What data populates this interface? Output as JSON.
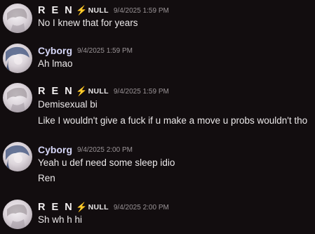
{
  "messages": [
    {
      "author": "R E N",
      "badge": {
        "icon": "lightning-bolt-icon",
        "label": "NULL"
      },
      "timestamp": "9/4/2025 1:59 PM",
      "lines": [
        "No I knew that for years"
      ]
    },
    {
      "author": "Cyborg",
      "timestamp": "9/4/2025 1:59 PM",
      "lines": [
        "Ah lmao"
      ]
    },
    {
      "author": "R E N",
      "badge": {
        "icon": "lightning-bolt-icon",
        "label": "NULL"
      },
      "timestamp": "9/4/2025 1:59 PM",
      "lines": [
        "Demisexual bi",
        "Like I wouldn't give a fuck if u make a move u probs wouldn't tho"
      ]
    },
    {
      "author": "Cyborg",
      "timestamp": "9/4/2025 2:00 PM",
      "lines": [
        "Yeah u def need some sleep idio",
        "Ren"
      ]
    },
    {
      "author": "R E N",
      "badge": {
        "icon": "lightning-bolt-icon",
        "label": "NULL"
      },
      "timestamp": "9/4/2025 2:00 PM",
      "lines": [
        "Sh wh h hi"
      ]
    }
  ],
  "colors": {
    "background": "#120d0f",
    "ren_name": "#f2eff0",
    "cyborg_name": "#d5d6f6",
    "timestamp": "#9a9497",
    "badge_bolt": "#e7c43c"
  }
}
